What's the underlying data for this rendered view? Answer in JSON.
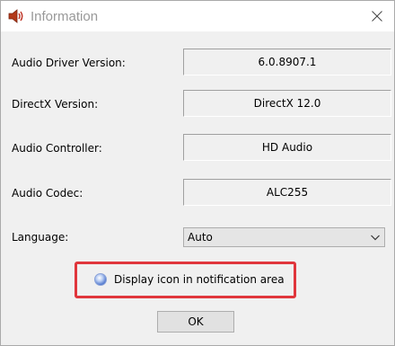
{
  "window": {
    "title": "Information",
    "icon": "speaker-icon",
    "close_icon": "close-icon"
  },
  "rows": [
    {
      "label": "Audio Driver Version:",
      "value": "6.0.8907.1"
    },
    {
      "label": "DirectX Version:",
      "value": "DirectX 12.0"
    },
    {
      "label": "Audio Controller:",
      "value": "HD Audio"
    },
    {
      "label": "Audio Codec:",
      "value": "ALC255"
    }
  ],
  "language": {
    "label": "Language:",
    "selected": "Auto"
  },
  "notification_option": {
    "label": "Display icon in notification area",
    "highlight_color": "#e0363c"
  },
  "buttons": {
    "ok_label": "OK"
  }
}
